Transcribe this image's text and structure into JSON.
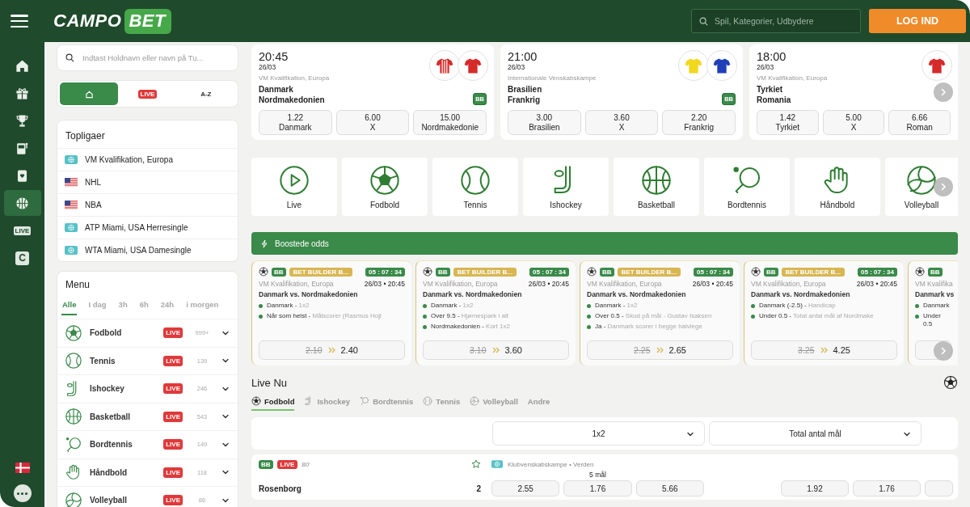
{
  "header": {
    "logo": {
      "text": "CAMPO",
      "badge": "BET"
    },
    "search": {
      "placeholder": "Spil, Kategorier, Udbydere"
    },
    "login_button": "LOG IND"
  },
  "rail": {
    "items": [
      {
        "kind": "home",
        "selected": false
      },
      {
        "kind": "gift",
        "selected": false
      },
      {
        "kind": "trophy",
        "selected": false
      },
      {
        "kind": "slot",
        "selected": false
      },
      {
        "kind": "card",
        "selected": false
      },
      {
        "kind": "sports",
        "selected": true
      },
      {
        "kind": "live",
        "label": "LIVE",
        "selected": false
      },
      {
        "kind": "letter",
        "label": "C",
        "selected": false
      }
    ]
  },
  "sidebar": {
    "search": {
      "placeholder": "Indtast Holdnavn eller navn på Tu..."
    },
    "view_tabs": [
      {
        "kind": "home",
        "selected": true
      },
      {
        "kind": "live",
        "label": "LIVE",
        "selected": false
      },
      {
        "kind": "az",
        "label": "A-Z",
        "selected": false
      }
    ],
    "top_leagues": {
      "title": "Topligaer",
      "items": [
        {
          "kind": "world",
          "name": "VM Kvalifikation, Europa"
        },
        {
          "kind": "usa",
          "name": "NHL"
        },
        {
          "kind": "usa",
          "name": "NBA"
        },
        {
          "kind": "world",
          "name": "ATP Miami, USA Herresingle"
        },
        {
          "kind": "world",
          "name": "WTA Miami, USA Damesingle"
        }
      ]
    },
    "menu": {
      "title": "Menu",
      "periods": [
        {
          "label": "Alle",
          "selected": true
        },
        {
          "label": "I dag",
          "selected": false
        },
        {
          "label": "3h",
          "selected": false
        },
        {
          "label": "6h",
          "selected": false
        },
        {
          "label": "24h",
          "selected": false
        },
        {
          "label": "i morgen",
          "selected": false
        }
      ],
      "sports": [
        {
          "kind": "football",
          "name": "Fodbold",
          "badge": "LIVE",
          "count": "999+"
        },
        {
          "kind": "tennis",
          "name": "Tennis",
          "badge": "LIVE",
          "count": "139"
        },
        {
          "kind": "hockey",
          "name": "Ishockey",
          "badge": "LIVE",
          "count": "246"
        },
        {
          "kind": "basketball",
          "name": "Basketball",
          "badge": "LIVE",
          "count": "543"
        },
        {
          "kind": "tabletennis",
          "name": "Bordtennis",
          "badge": "LIVE",
          "count": "149"
        },
        {
          "kind": "handball",
          "name": "Håndbold",
          "badge": "LIVE",
          "count": "118"
        },
        {
          "kind": "volleyball",
          "name": "Volleyball",
          "badge": "LIVE",
          "count": "86"
        }
      ]
    }
  },
  "featured_matches": [
    {
      "time": "20:45",
      "date": "26/03",
      "league": "VM Kvalifikation, Europa",
      "badge": "BB",
      "teams": [
        {
          "name": "Danmark",
          "color": "#d62b2b",
          "striped": true
        },
        {
          "name": "Nordmakedonien",
          "color": "#d62b2b",
          "striped": false
        }
      ],
      "odds": [
        {
          "value": "1.22",
          "label": "Danmark"
        },
        {
          "value": "6.00",
          "label": "X"
        },
        {
          "value": "15.00",
          "label": "Nordmakedonie"
        }
      ]
    },
    {
      "time": "21:00",
      "date": "26/03",
      "league": "Internationale Venskabskampe",
      "badge": "BB",
      "teams": [
        {
          "name": "Brasilien",
          "color": "#f2d81c",
          "striped": false
        },
        {
          "name": "Frankrig",
          "color": "#1f3fb8",
          "striped": false
        }
      ],
      "odds": [
        {
          "value": "3.00",
          "label": "Brasilien"
        },
        {
          "value": "3.60",
          "label": "X"
        },
        {
          "value": "2.20",
          "label": "Frankrig"
        }
      ]
    },
    {
      "time": "18:00",
      "date": "26/03",
      "league": "VM Kvalifikation, Europa",
      "teams": [
        {
          "name": "Tyrkiet",
          "color": "#d62b2b",
          "striped": false
        },
        {
          "name": "Romania"
        }
      ],
      "odds": [
        {
          "value": "1.42",
          "label": "Tyrkiet"
        },
        {
          "value": "5.00",
          "label": "X"
        },
        {
          "value": "6.66",
          "label": "Roman"
        }
      ]
    }
  ],
  "sports_tiles": [
    {
      "kind": "live",
      "label": "Live"
    },
    {
      "kind": "football",
      "label": "Fodbold"
    },
    {
      "kind": "tennis",
      "label": "Tennis"
    },
    {
      "kind": "hockey",
      "label": "Ishockey"
    },
    {
      "kind": "basketball",
      "label": "Basketball"
    },
    {
      "kind": "tabletennis",
      "label": "Bordtennis"
    },
    {
      "kind": "handball",
      "label": "Håndbold"
    },
    {
      "kind": "volleyball",
      "label": "Volleyball"
    }
  ],
  "boosted_odds": {
    "title": "Boostede odds",
    "cards": [
      {
        "badge": "BB",
        "promo": "BET BUILDER B...",
        "timer": "05 : 07 : 34",
        "league": "VM Kvalifikation, Europa",
        "date": "26/03 • 20:45",
        "match": "Danmark vs. Nordmakedonien",
        "legs": [
          {
            "pick": "Danmark -",
            "market": "1x2"
          },
          {
            "pick": "Når som helst -",
            "market": "Målscorer (Rasmus Hojl"
          }
        ],
        "old_odds": "2.10",
        "new_odds": "2.40"
      },
      {
        "badge": "BB",
        "promo": "BET BUILDER B...",
        "timer": "05 : 07 : 34",
        "league": "VM Kvalifikation, Europa",
        "date": "26/03 • 20:45",
        "match": "Danmark vs. Nordmakedonien",
        "legs": [
          {
            "pick": "Danmark -",
            "market": "1x2"
          },
          {
            "pick": "Over 9.5 -",
            "market": "Hjørnespark i alt"
          },
          {
            "pick": "Nordmakedonien -",
            "market": "Kort 1x2"
          }
        ],
        "old_odds": "3.10",
        "new_odds": "3.60"
      },
      {
        "badge": "BB",
        "promo": "BET BUILDER B...",
        "timer": "05 : 07 : 34",
        "league": "VM Kvalifikation, Europa",
        "date": "26/03 • 20:45",
        "match": "Danmark vs. Nordmakedonien",
        "legs": [
          {
            "pick": "Danmark -",
            "market": "1x2"
          },
          {
            "pick": "Over 0.5 -",
            "market": "Skud på mål - Gustav Isaksen"
          },
          {
            "pick": "Ja -",
            "market": "Danmark scorer i begge halvlege"
          }
        ],
        "old_odds": "2.25",
        "new_odds": "2.65"
      },
      {
        "badge": "BB",
        "promo": "BET BUILDER B...",
        "timer": "05 : 07 : 34",
        "league": "VM Kvalifikation, Europa",
        "date": "26/03 • 20:45",
        "match": "Danmark vs. Nordmakedonien",
        "legs": [
          {
            "pick": "Danmark (-2.5) -",
            "market": "Handicap"
          },
          {
            "pick": "Under 0.5 -",
            "market": "Total antal mål af Nordmake"
          }
        ],
        "old_odds": "3.25",
        "new_odds": "4.25"
      },
      {
        "badge": "BB",
        "league": "VM Kvalifika",
        "match": "Danmark vs",
        "legs": [
          {
            "pick": "Danmark"
          },
          {
            "pick": "Under 0.5"
          }
        ]
      }
    ]
  },
  "live": {
    "title": "Live Nu",
    "tabs": [
      {
        "kind": "football",
        "label": "Fodbold",
        "selected": true
      },
      {
        "kind": "hockey",
        "label": "Ishockey",
        "selected": false
      },
      {
        "kind": "tabletennis",
        "label": "Bordtennis",
        "selected": false
      },
      {
        "kind": "tennis",
        "label": "Tennis",
        "selected": false
      },
      {
        "kind": "volleyball",
        "label": "Volleyball",
        "selected": false
      },
      {
        "kind": "other",
        "label": "Andre",
        "selected": false
      }
    ],
    "markets": [
      "1x2",
      "Total antal mål"
    ],
    "matches": [
      {
        "badge": "BB",
        "live": "LIVE",
        "minute": "80'",
        "favorite": false,
        "league": {
          "kind": "world",
          "name": "Klubvenskabskampe • Verden"
        },
        "market_note": "5 mål",
        "team": "Rosenborg",
        "score": "2",
        "odds_1x2": [
          "2.55",
          "1.76",
          "5.66"
        ],
        "odds_total": [
          "1.92",
          "1.76"
        ]
      }
    ]
  }
}
